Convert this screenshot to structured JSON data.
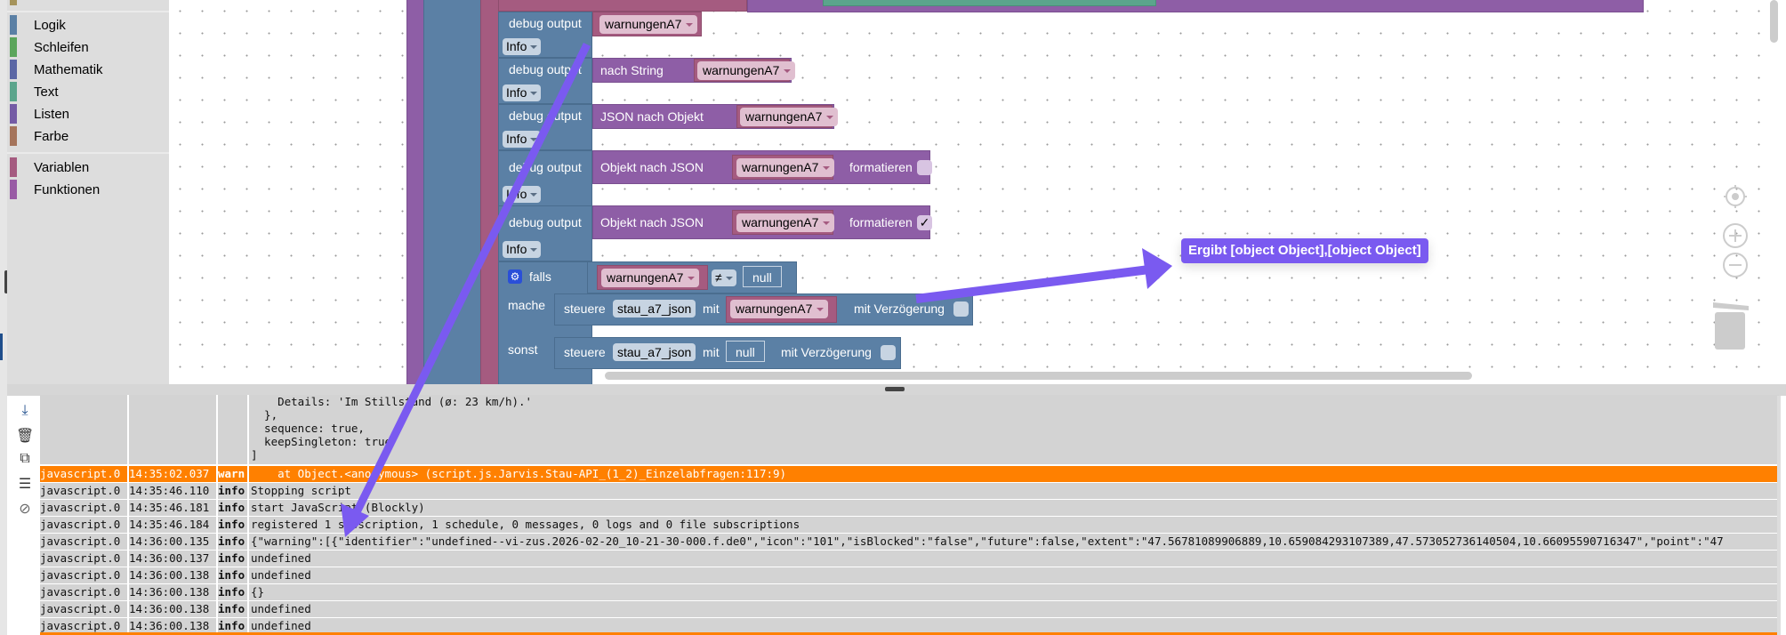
{
  "toolbox": {
    "items": [
      {
        "label": "Logik",
        "color": "#5b80a5"
      },
      {
        "label": "Schleifen",
        "color": "#5ba55b"
      },
      {
        "label": "Mathematik",
        "color": "#5b67a5"
      },
      {
        "label": "Text",
        "color": "#5ba58c"
      },
      {
        "label": "Listen",
        "color": "#745ba5"
      },
      {
        "label": "Farbe",
        "color": "#a5745b"
      },
      {
        "label": "Variablen",
        "color": "#a55b80"
      },
      {
        "label": "Funktionen",
        "color": "#995ba5"
      }
    ]
  },
  "blocks": {
    "debug_label": "debug output",
    "level": "Info",
    "var": "warnungenA7",
    "to_string": "nach String",
    "json_to_obj": "JSON nach Objekt",
    "obj_to_json": "Objekt nach JSON",
    "format": "formatieren",
    "format_checked_4": false,
    "format_checked_5": true,
    "check_mark": "✓",
    "if_label": "falls",
    "do_label": "mache",
    "else_label": "sonst",
    "op": "≠",
    "null": "null",
    "set_label": "steuere",
    "state": "stau_a7_json",
    "with_label": "mit",
    "delay_label": "mit Verzögerung"
  },
  "annotation": {
    "text": "Ergibt [object Object],[object Object]",
    "color": "#7a5af0"
  },
  "log": {
    "first_message": "    Details: 'Im Stillstand (ø: 23 km/h).'\n  },\n  sequence: true,\n  keepSingleton: true\n]",
    "rows": [
      {
        "source": "javascript.0",
        "time": "14:35:02.037",
        "level": "warn",
        "message": "    at Object.<anonymous> (script.js.Jarvis.Stau-API_(1_2)_Einzelabfragen:117:9)"
      },
      {
        "source": "javascript.0",
        "time": "14:35:46.110",
        "level": "info",
        "message": "Stopping script"
      },
      {
        "source": "javascript.0",
        "time": "14:35:46.181",
        "level": "info",
        "message": "start JavaScript (Blockly)"
      },
      {
        "source": "javascript.0",
        "time": "14:35:46.184",
        "level": "info",
        "message": "registered 1 subscription, 1 schedule, 0 messages, 0 logs and 0 file subscriptions"
      },
      {
        "source": "javascript.0",
        "time": "14:36:00.135",
        "level": "info",
        "message": "{\"warning\":[{\"identifier\":\"undefined--vi-zus.2026-02-20_10-21-30-000.f.de0\",\"icon\":\"101\",\"isBlocked\":\"false\",\"future\":false,\"extent\":\"47.56781089906889,10.659084293107389,47.573052736140504,10.66095590716347\",\"point\":\"47"
      },
      {
        "source": "javascript.0",
        "time": "14:36:00.137",
        "level": "info",
        "message": "undefined"
      },
      {
        "source": "javascript.0",
        "time": "14:36:00.138",
        "level": "info",
        "message": "undefined"
      },
      {
        "source": "javascript.0",
        "time": "14:36:00.138",
        "level": "info",
        "message": "{}"
      },
      {
        "source": "javascript.0",
        "time": "14:36:00.138",
        "level": "info",
        "message": "undefined"
      },
      {
        "source": "javascript.0",
        "time": "14:36:00.138",
        "level": "info",
        "message": "undefined"
      }
    ]
  }
}
